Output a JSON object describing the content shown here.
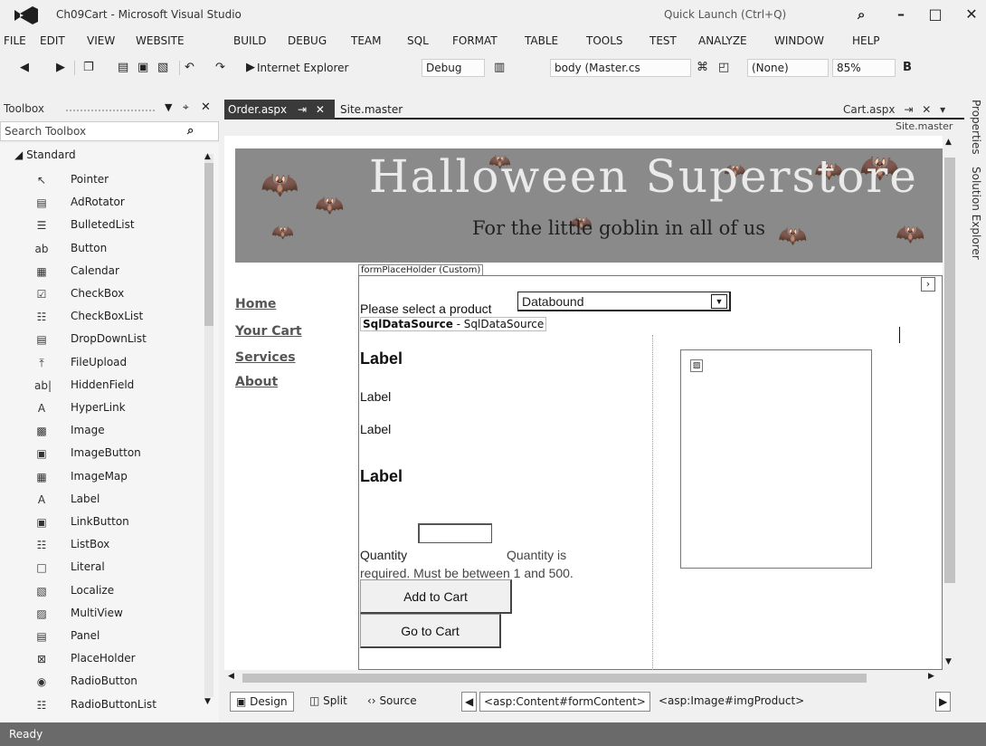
{
  "window": {
    "title": "Ch09Cart - Microsoft Visual Studio",
    "quick_launch_placeholder": "Quick Launch (Ctrl+Q)",
    "controls": {
      "minimize": "–",
      "maximize": "□",
      "close": "✕"
    }
  },
  "menu": [
    "FILE",
    "EDIT",
    "VIEW",
    "WEBSITE",
    "BUILD",
    "DEBUG",
    "TEAM",
    "SQL",
    "FORMAT",
    "TABLE",
    "TOOLS",
    "TEST",
    "ANALYZE",
    "WINDOW",
    "HELP"
  ],
  "toolbar": {
    "browser": "Internet Explorer",
    "config": "Debug",
    "element": "body (Master.cs",
    "style": "(None)",
    "zoom": "85%",
    "bold": "B"
  },
  "toolbox": {
    "title": "Toolbox",
    "search_placeholder": "Search Toolbox",
    "group": "Standard",
    "items": [
      {
        "label": "Pointer",
        "icon": "pointer-icon",
        "glyph": "↖"
      },
      {
        "label": "AdRotator",
        "icon": "adrotator-icon",
        "glyph": "▤"
      },
      {
        "label": "BulletedList",
        "icon": "bulleted-list-icon",
        "glyph": "☰"
      },
      {
        "label": "Button",
        "icon": "button-icon",
        "glyph": "ab"
      },
      {
        "label": "Calendar",
        "icon": "calendar-icon",
        "glyph": "▦"
      },
      {
        "label": "CheckBox",
        "icon": "checkbox-icon",
        "glyph": "☑"
      },
      {
        "label": "CheckBoxList",
        "icon": "checkbox-list-icon",
        "glyph": "☷"
      },
      {
        "label": "DropDownList",
        "icon": "dropdown-list-icon",
        "glyph": "▤"
      },
      {
        "label": "FileUpload",
        "icon": "file-upload-icon",
        "glyph": "⤒"
      },
      {
        "label": "HiddenField",
        "icon": "hidden-field-icon",
        "glyph": "ab|"
      },
      {
        "label": "HyperLink",
        "icon": "hyperlink-icon",
        "glyph": "A"
      },
      {
        "label": "Image",
        "icon": "image-icon",
        "glyph": "▩"
      },
      {
        "label": "ImageButton",
        "icon": "image-button-icon",
        "glyph": "▣"
      },
      {
        "label": "ImageMap",
        "icon": "image-map-icon",
        "glyph": "▦"
      },
      {
        "label": "Label",
        "icon": "label-icon",
        "glyph": "A"
      },
      {
        "label": "LinkButton",
        "icon": "link-button-icon",
        "glyph": "▣"
      },
      {
        "label": "ListBox",
        "icon": "listbox-icon",
        "glyph": "☷"
      },
      {
        "label": "Literal",
        "icon": "literal-icon",
        "glyph": "□"
      },
      {
        "label": "Localize",
        "icon": "localize-icon",
        "glyph": "▧"
      },
      {
        "label": "MultiView",
        "icon": "multiview-icon",
        "glyph": "▨"
      },
      {
        "label": "Panel",
        "icon": "panel-icon",
        "glyph": "▤"
      },
      {
        "label": "PlaceHolder",
        "icon": "placeholder-icon",
        "glyph": "⊠"
      },
      {
        "label": "RadioButton",
        "icon": "radio-button-icon",
        "glyph": "◉"
      },
      {
        "label": "RadioButtonList",
        "icon": "radio-button-list-icon",
        "glyph": "☷"
      }
    ]
  },
  "tabs": {
    "active": "Order.aspx",
    "active_pin": "⇥",
    "active_close": "✕",
    "second": "Site.master",
    "right": "Cart.aspx",
    "right_pin": "⇥",
    "right_close": "✕",
    "right_arrow": "▾"
  },
  "master_label": "Site.master",
  "side_tabs": [
    "Properties",
    "Solution Explorer"
  ],
  "page": {
    "banner_title": "Halloween Superstore",
    "banner_subtitle": "For the little goblin in all of us",
    "nav": [
      "Home",
      "Your Cart",
      "Services",
      "About"
    ],
    "placeholder_tag": "formPlaceHolder (Custom)",
    "select_label": "Please select a product",
    "select_value": "Databound",
    "sqlds_bold": "SqlDataSource",
    "sqlds_rest": " - SqlDataSource",
    "labels": [
      "Label",
      "Label",
      "Label",
      "Label"
    ],
    "qty_label": "Quantity",
    "qty_required": "Quantity is",
    "qty_range": "required.   Must be between 1 and 500.",
    "add_button": "Add to Cart",
    "go_button": "Go to Cart"
  },
  "viewbar": {
    "design": "Design",
    "split": "Split",
    "source": "Source",
    "crumb1": "<asp:Content#formContent>",
    "crumb2": "<asp:Image#imgProduct>"
  },
  "status": "Ready"
}
